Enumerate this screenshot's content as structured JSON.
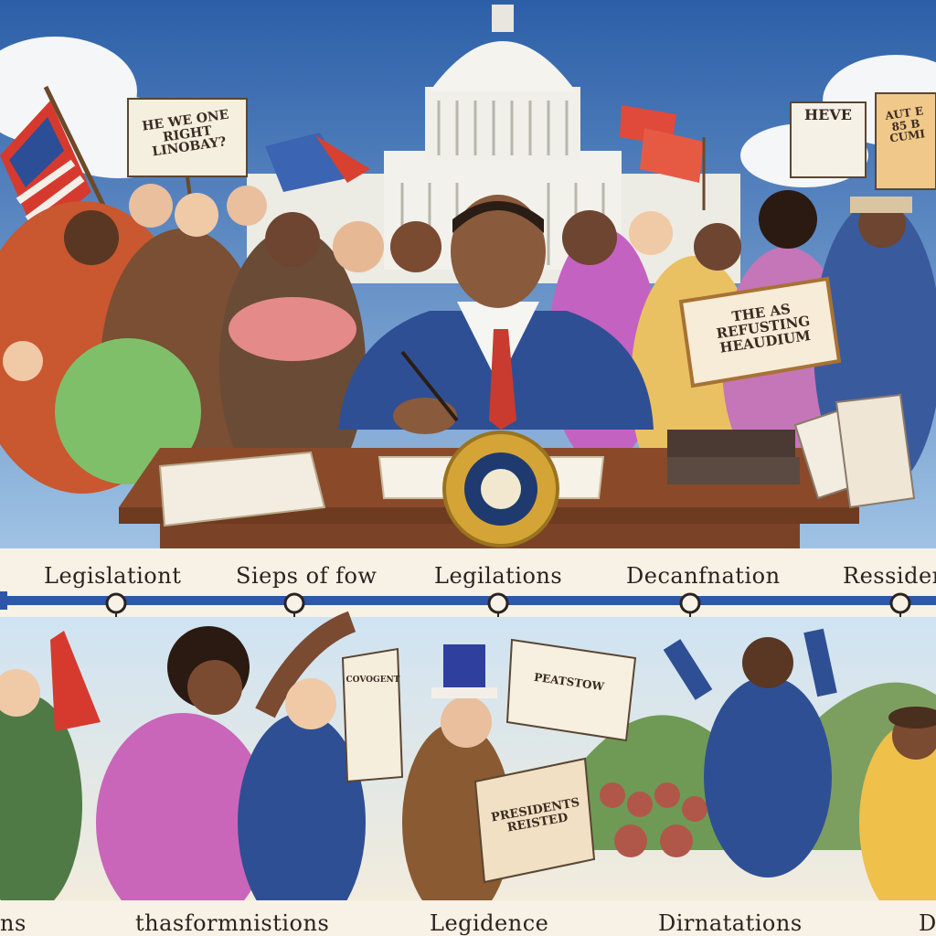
{
  "top_labels": [
    "Legislationt",
    "Sieps of fow",
    "Legilations",
    "Decanfnation",
    "Ressideriz"
  ],
  "bottom_labels": [
    "ns",
    "thasformnistions",
    "Legidence",
    "Dirnatations",
    "D"
  ],
  "signs": {
    "left_sign": "HE WE ONE\nRIGHT\nLINOBAY?",
    "right_top_sign": "HEVE",
    "far_right_sign": "AUT E\n85 B\nCUMI",
    "banner_sign": "THE AS\nREFUSTING\nHEAUDIUM",
    "bottom_sign_a": "COVOGENT",
    "bottom_sign_b": "PRESIDENTS\nREISTED",
    "bottom_sign_c": "PEATSTOW"
  },
  "colors": {
    "sky": "#3a6fb5",
    "capitol": "#f2f1ec",
    "suit_blue": "#2f4f94",
    "desk": "#8a4a2a",
    "timeline": "#2f56a8",
    "seal_gold": "#d4a437"
  }
}
